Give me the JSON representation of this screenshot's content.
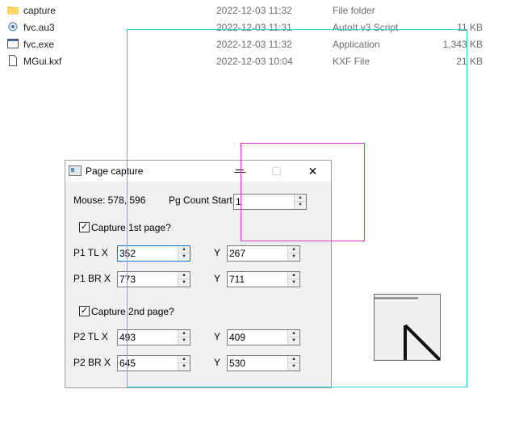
{
  "files": [
    {
      "name": "capture",
      "date": "2022-12-03 11:32",
      "type": "File folder",
      "size": "",
      "icon": "folder-icon"
    },
    {
      "name": "fvc.au3",
      "date": "2022-12-03 11:31",
      "type": "AutoIt v3 Script",
      "size": "11 KB",
      "icon": "autoit-script-icon"
    },
    {
      "name": "fvc.exe",
      "date": "2022-12-03 11:32",
      "type": "Application",
      "size": "1,343 KB",
      "icon": "application-icon"
    },
    {
      "name": "MGui.kxf",
      "date": "2022-12-03 10:04",
      "type": "KXF File",
      "size": "21 KB",
      "icon": "document-icon"
    }
  ],
  "dialog": {
    "title": "Page capture",
    "minimize": "—",
    "maximize": "☐",
    "close": "✕",
    "mouse_label": "Mouse: 578, 596",
    "pg_count_label": "Pg Count Start",
    "pg_count_value": "1",
    "capture1_label": "Capture 1st page?",
    "capture1_checked": "✓",
    "p1tl_label": "P1 TL  X",
    "p1tl_x": "352",
    "p1tl_y": "267",
    "p1br_label": "P1 BR  X",
    "p1br_x": "773",
    "p1br_y": "711",
    "capture2_label": "Capture 2nd page?",
    "capture2_checked": "✓",
    "p2tl_label": "P2 TL  X",
    "p2tl_x": "493",
    "p2tl_y": "409",
    "p2br_label": "P2 BR  X",
    "p2br_x": "645",
    "p2br_y": "530",
    "y_label": "Y",
    "spin_up": "▲",
    "spin_down": "▼"
  },
  "colors": {
    "selection_outer": "#27d3d3",
    "selection_inner": "#d63ad6",
    "focus": "#0078d7"
  }
}
